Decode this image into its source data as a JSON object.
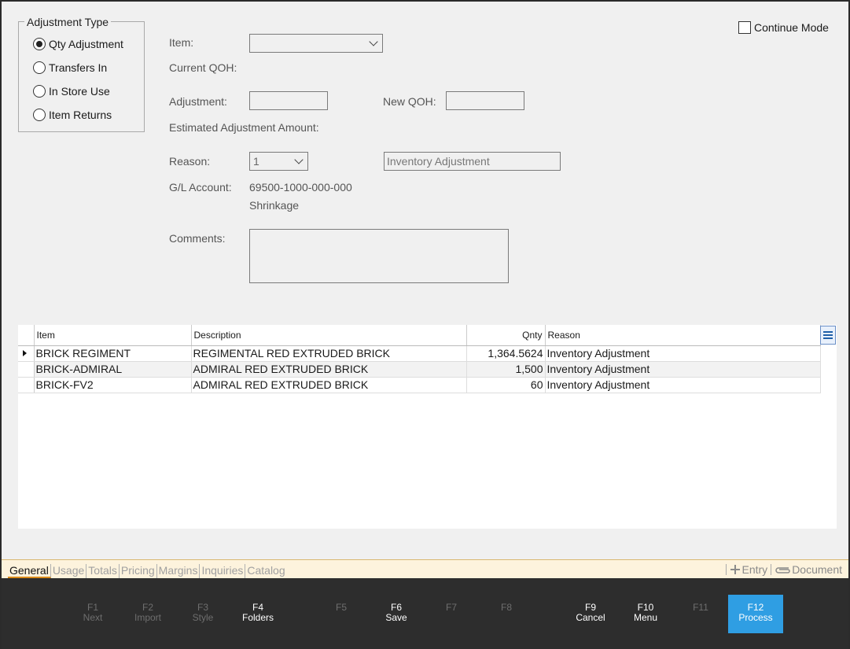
{
  "adjustment_type": {
    "legend": "Adjustment Type",
    "options": [
      {
        "label": "Qty Adjustment",
        "checked": true
      },
      {
        "label": "Transfers In",
        "checked": false
      },
      {
        "label": "In Store Use",
        "checked": false
      },
      {
        "label": "Item Returns",
        "checked": false
      }
    ]
  },
  "continue_mode": {
    "label": "Continue Mode",
    "checked": false
  },
  "form": {
    "item_label": "Item:",
    "item_value": "",
    "current_qoh_label": "Current QOH:",
    "adjustment_label": "Adjustment:",
    "adjustment_value": "",
    "new_qoh_label": "New QOH:",
    "new_qoh_value": "",
    "estimated_label": "Estimated Adjustment Amount:",
    "reason_label": "Reason:",
    "reason_code": "1",
    "reason_desc": "Inventory Adjustment",
    "gl_label": "G/L Account:",
    "gl_account": "69500-1000-000-000",
    "gl_name": "Shrinkage",
    "comments_label": "Comments:",
    "comments_value": ""
  },
  "grid": {
    "headers": [
      "Item",
      "Description",
      "Qnty",
      "Reason"
    ],
    "rows": [
      {
        "item": "BRICK REGIMENT",
        "description": "REGIMENTAL RED EXTRUDED BRICK",
        "qnty": "1,364.5624",
        "reason": "Inventory Adjustment"
      },
      {
        "item": "BRICK-ADMIRAL",
        "description": "ADMIRAL RED EXTRUDED BRICK",
        "qnty": "1,500",
        "reason": "Inventory Adjustment"
      },
      {
        "item": "BRICK-FV2",
        "description": "ADMIRAL RED EXTRUDED BRICK",
        "qnty": "60",
        "reason": "Inventory Adjustment"
      }
    ]
  },
  "tabs": [
    "General",
    "Usage",
    "Totals",
    "Pricing",
    "Margins",
    "Inquiries",
    "Catalog"
  ],
  "tab_actions": {
    "entry": "Entry",
    "document": "Document"
  },
  "fkeys": [
    {
      "key": "F1",
      "label": "Next"
    },
    {
      "key": "F2",
      "label": "Import"
    },
    {
      "key": "F3",
      "label": "Style"
    },
    {
      "key": "F4",
      "label": "Folders"
    },
    {
      "key": "F5",
      "label": ""
    },
    {
      "key": "F6",
      "label": "Save"
    },
    {
      "key": "F7",
      "label": ""
    },
    {
      "key": "F8",
      "label": ""
    },
    {
      "key": "F9",
      "label": "Cancel"
    },
    {
      "key": "F10",
      "label": "Menu"
    },
    {
      "key": "F11",
      "label": ""
    },
    {
      "key": "F12",
      "label": "Process"
    }
  ],
  "colors": {
    "accent": "#2f9ee3",
    "tab_strip": "#fdf3dd",
    "fkey_bar": "#2d2d2d"
  }
}
